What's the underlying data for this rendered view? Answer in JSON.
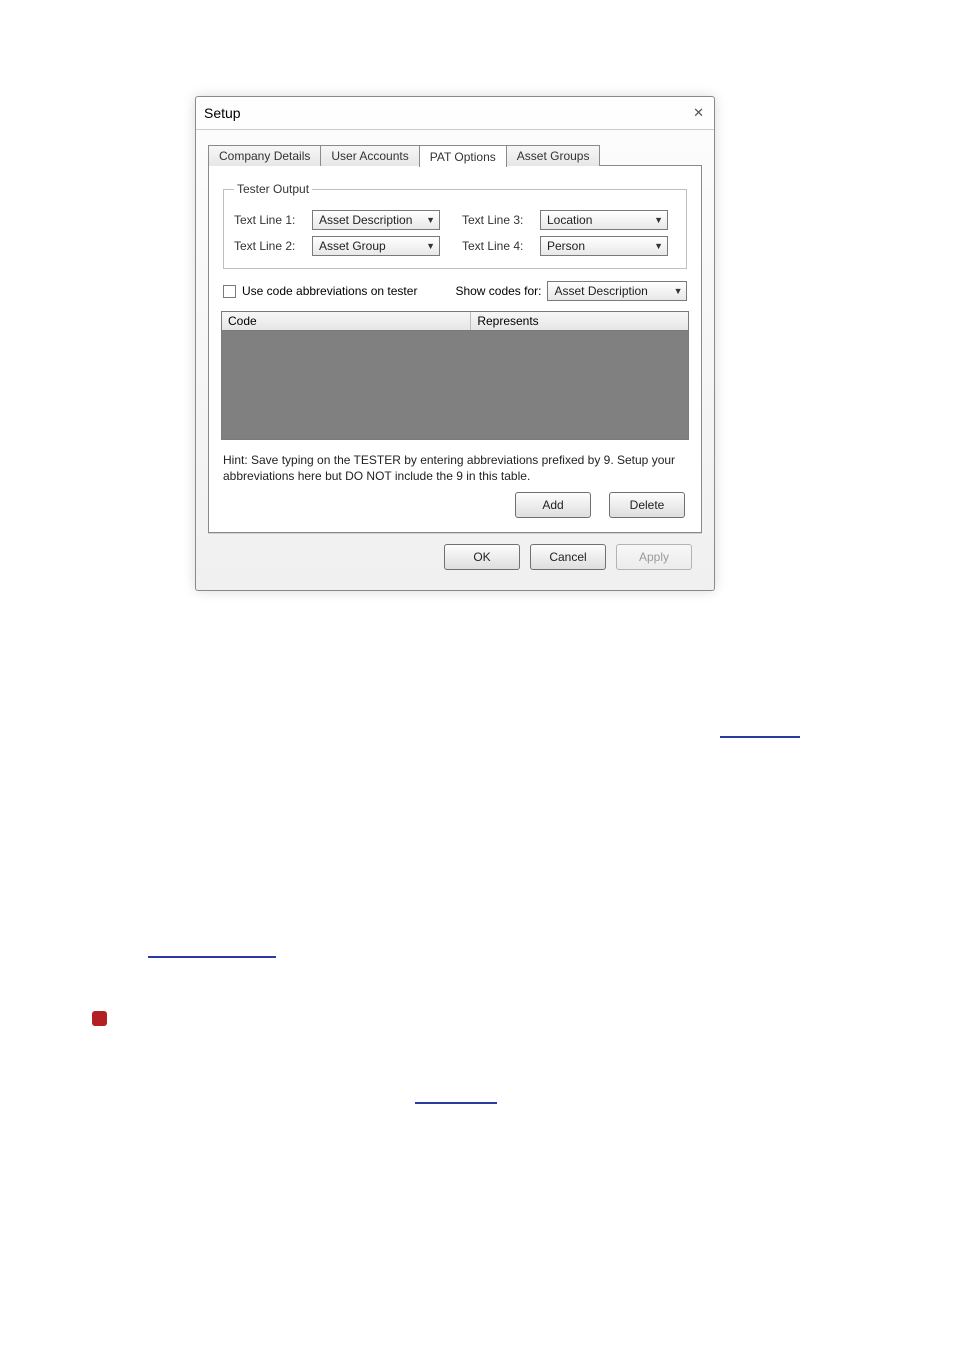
{
  "dialog": {
    "title": "Setup",
    "tabs": {
      "company": "Company Details",
      "users": "User Accounts",
      "pat": "PAT Options",
      "groups": "Asset Groups"
    },
    "panel": {
      "tester_output_legend": "Tester Output",
      "line1_label": "Text Line 1:",
      "line1_value": "Asset Description",
      "line2_label": "Text Line 2:",
      "line2_value": "Asset Group",
      "line3_label": "Text Line 3:",
      "line3_value": "Location",
      "line4_label": "Text Line 4:",
      "line4_value": "Person",
      "use_codes_label": "Use code abbreviations on tester",
      "show_codes_for_label": "Show codes for:",
      "show_codes_for_value": "Asset Description",
      "col_code": "Code",
      "col_represents": "Represents",
      "hint": "Hint: Save typing on the TESTER by entering abbreviations prefixed by 9. Setup your abbreviations here but DO NOT include the 9 in this table.",
      "add_btn": "Add",
      "delete_btn": "Delete"
    },
    "buttons": {
      "ok": "OK",
      "cancel": "Cancel",
      "apply": "Apply"
    }
  }
}
